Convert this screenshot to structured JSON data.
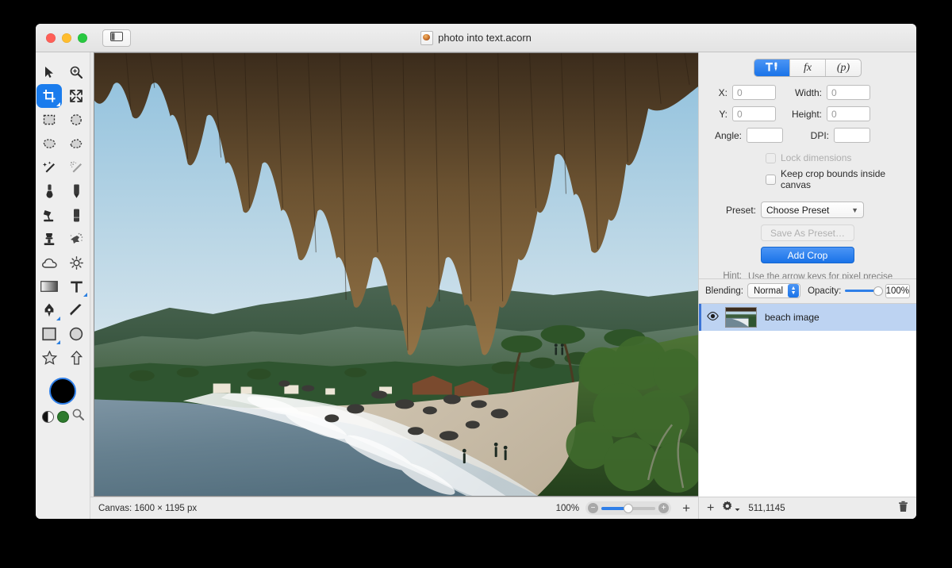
{
  "window": {
    "title": "photo into text.acorn",
    "traffic_lights": [
      "close-button",
      "minimize-button",
      "zoom-button"
    ],
    "sidebar_toggle_icon": "sidebar-toggle-icon",
    "document_icon": "acorn-document-icon"
  },
  "toolbar": {
    "tools": [
      {
        "name": "move-tool",
        "icon": "arrow-cursor-icon",
        "selected": false,
        "submenu": false
      },
      {
        "name": "zoom-tool",
        "icon": "magnifier-plus-icon",
        "selected": false,
        "submenu": false
      },
      {
        "name": "crop-tool",
        "icon": "crop-icon",
        "selected": true,
        "submenu": true
      },
      {
        "name": "transform-tool",
        "icon": "arrows-expand-icon",
        "selected": false,
        "submenu": false
      },
      {
        "name": "rectangle-select-tool",
        "icon": "marquee-rect-icon",
        "selected": false,
        "submenu": false
      },
      {
        "name": "ellipse-select-tool",
        "icon": "marquee-ellipse-icon",
        "selected": false,
        "submenu": false
      },
      {
        "name": "lasso-tool",
        "icon": "lasso-icon",
        "selected": false,
        "submenu": false
      },
      {
        "name": "polygon-lasso-tool",
        "icon": "polygon-lasso-icon",
        "selected": false,
        "submenu": false
      },
      {
        "name": "magic-wand-tool",
        "icon": "magic-wand-icon",
        "selected": false,
        "submenu": false
      },
      {
        "name": "instant-alpha-tool",
        "icon": "sparkle-wand-icon",
        "selected": false,
        "submenu": false
      },
      {
        "name": "brush-tool",
        "icon": "paint-brush-icon",
        "selected": false,
        "submenu": false
      },
      {
        "name": "pencil-tool",
        "icon": "pencil-icon",
        "selected": false,
        "submenu": false
      },
      {
        "name": "paint-bucket-tool",
        "icon": "paint-bucket-icon",
        "selected": false,
        "submenu": false
      },
      {
        "name": "eraser-tool",
        "icon": "eraser-icon",
        "selected": false,
        "submenu": false
      },
      {
        "name": "clone-stamp-tool",
        "icon": "clone-stamp-icon",
        "selected": false,
        "submenu": false
      },
      {
        "name": "smudge-tool",
        "icon": "smudge-icon",
        "selected": false,
        "submenu": false
      },
      {
        "name": "blur-tool",
        "icon": "cloud-blur-icon",
        "selected": false,
        "submenu": false
      },
      {
        "name": "dodge-tool",
        "icon": "sun-dodge-icon",
        "selected": false,
        "submenu": false
      },
      {
        "name": "gradient-tool",
        "icon": "gradient-icon",
        "selected": false,
        "submenu": false
      },
      {
        "name": "text-tool",
        "icon": "text-t-icon",
        "selected": false,
        "submenu": true
      },
      {
        "name": "bezier-pen-tool",
        "icon": "bezier-pen-icon",
        "selected": false,
        "submenu": true
      },
      {
        "name": "line-tool",
        "icon": "line-icon",
        "selected": false,
        "submenu": false
      },
      {
        "name": "rectangle-shape-tool",
        "icon": "rectangle-shape-icon",
        "selected": false,
        "submenu": true
      },
      {
        "name": "ellipse-shape-tool",
        "icon": "ellipse-shape-icon",
        "selected": false,
        "submenu": false
      },
      {
        "name": "star-shape-tool",
        "icon": "star-shape-icon",
        "selected": false,
        "submenu": false
      },
      {
        "name": "arrow-shape-tool",
        "icon": "arrow-shape-icon",
        "selected": false,
        "submenu": false
      }
    ],
    "colors": {
      "foreground": "#000000",
      "background": "#2d7a2d",
      "swap_icon": "half-circle-swap-icon",
      "picker_icon": "magnifier-color-picker-icon"
    }
  },
  "inspector": {
    "segments": [
      {
        "name": "tools-segment",
        "label": "",
        "icon": "tools-hammer-pen-icon",
        "selected": true
      },
      {
        "name": "filters-segment",
        "label": "fx",
        "icon": "fx-icon",
        "selected": false
      },
      {
        "name": "palette-segment",
        "label": "(p)",
        "icon": "palette-icon",
        "selected": false
      }
    ],
    "crop": {
      "x_label": "X:",
      "x_value": "0",
      "width_label": "Width:",
      "width_value": "0",
      "y_label": "Y:",
      "y_value": "0",
      "height_label": "Height:",
      "height_value": "0",
      "angle_label": "Angle:",
      "angle_value": "",
      "dpi_label": "DPI:",
      "dpi_value": "",
      "lock_dimensions_label": "Lock dimensions",
      "lock_dimensions_checked": false,
      "lock_dimensions_enabled": false,
      "keep_bounds_label": "Keep crop bounds inside canvas",
      "keep_bounds_checked": false,
      "preset_label": "Preset:",
      "preset_value": "Choose Preset",
      "save_preset_label": "Save As Preset…",
      "add_crop_label": "Add Crop",
      "hint_label": "Hint:",
      "hint_text": "Use the arrow keys for pixel precise placement."
    }
  },
  "layers": {
    "blending_label": "Blending:",
    "blending_value": "Normal",
    "opacity_label": "Opacity:",
    "opacity_value": "100%",
    "opacity_percent": 100,
    "items": [
      {
        "name": "beach image",
        "visible": true,
        "selected": true
      }
    ],
    "bottom_bar": {
      "add_layer_icon": "plus-icon",
      "settings_icon": "gear-dropdown-icon",
      "coordinates": "511,1145",
      "delete_icon": "trash-icon"
    }
  },
  "status_bar": {
    "canvas_size": "Canvas: 1600 × 1195 px",
    "zoom_level": "100%",
    "zoom_out_icon": "zoom-out-icon",
    "zoom_in_icon": "zoom-in-icon",
    "add_icon": "plus-icon"
  },
  "canvas": {
    "image_name": "beach-photograph",
    "description": "Beach scene with palm thatch roof, ocean, and hills"
  },
  "colors": {
    "accent": "#1a73e8",
    "selection": "#bdd3f2",
    "window_bg": "#ececec",
    "canvas_bg": "#e7e7e7"
  }
}
